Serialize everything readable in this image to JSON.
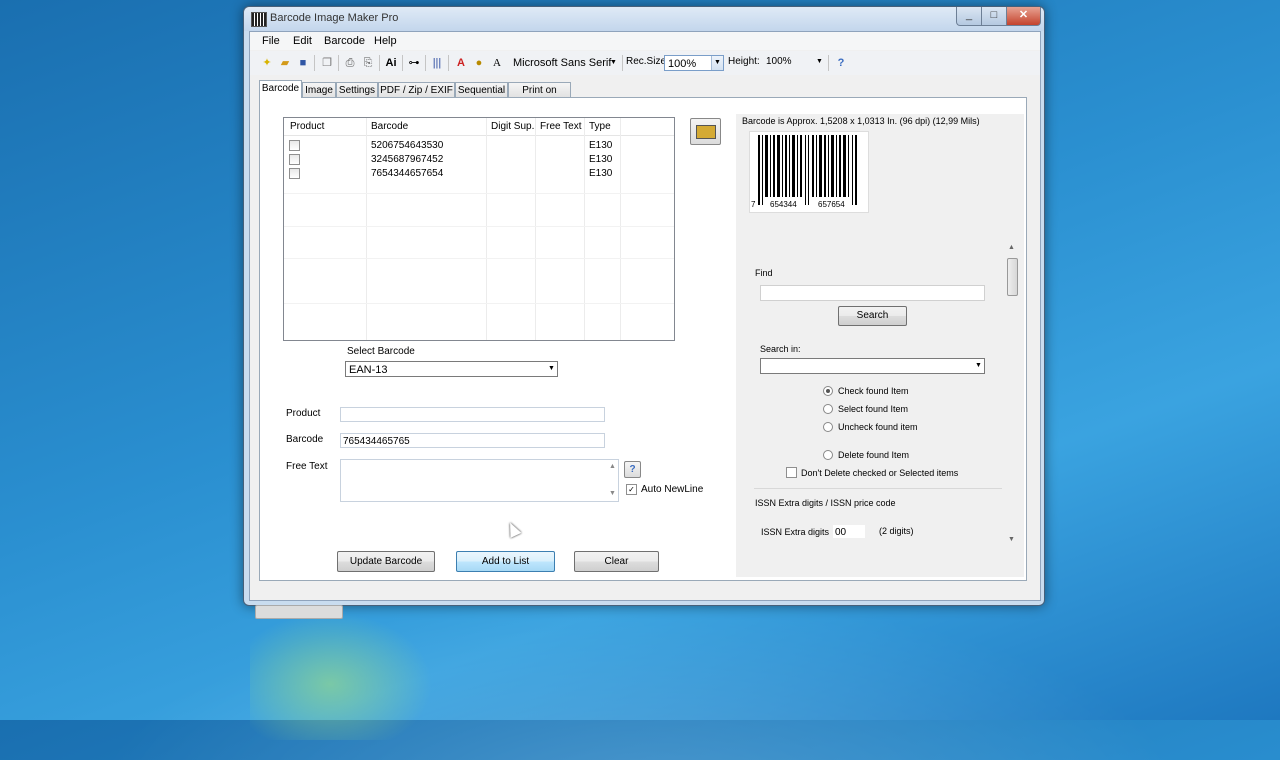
{
  "window": {
    "title": "Barcode Image Maker Pro",
    "min": "_",
    "max": "□",
    "close": "✕"
  },
  "menu": [
    "File",
    "Edit",
    "Barcode",
    "Help"
  ],
  "toolbar": {
    "font_name": "Microsoft Sans Serif",
    "rec_size_label": "Rec.Size",
    "rec_size_value": "100%",
    "height_label": "Height:",
    "height_value": "100%"
  },
  "tabs": [
    "Barcode",
    "Image",
    "Settings",
    "PDF / Zip / EXIF",
    "Sequential",
    "Print on Label"
  ],
  "list": {
    "columns": [
      "Product",
      "Barcode",
      "Digit Sup.",
      "Free Text",
      "Type"
    ],
    "rows": [
      {
        "product": "",
        "barcode": "5206754643530",
        "digit_sup": "",
        "free_text": "",
        "type": "E130"
      },
      {
        "product": "",
        "barcode": "3245687967452",
        "digit_sup": "",
        "free_text": "",
        "type": "E130"
      },
      {
        "product": "",
        "barcode": "7654344657654",
        "digit_sup": "",
        "free_text": "",
        "type": "E130"
      }
    ]
  },
  "select_barcode": {
    "label": "Select Barcode",
    "value": "EAN-13"
  },
  "form": {
    "product_label": "Product",
    "product_value": "",
    "barcode_label": "Barcode",
    "barcode_value": "765434465765",
    "free_text_label": "Free Text",
    "free_text_value": "",
    "auto_newline_label": "Auto NewLine",
    "help_glyph": "?"
  },
  "buttons": {
    "update": "Update Barcode",
    "add": "Add to List",
    "clear": "Clear"
  },
  "right": {
    "info": "Barcode is Approx. 1,5208 x 1,0313 In.  (96 dpi) (12,99 Mils)",
    "digits": [
      "7",
      "654344",
      "657654"
    ],
    "find_label": "Find",
    "find_value": "",
    "search_button": "Search",
    "search_in_label": "Search in:",
    "search_in_value": "",
    "radio_check": "Check found Item",
    "radio_select": "Select found Item",
    "radio_uncheck": "Uncheck found item",
    "radio_delete": "Delete found Item",
    "dont_delete": "Don't Delete checked or Selected items",
    "issn_group": "ISSN Extra digits / ISSN price code",
    "issn_label": "ISSN Extra digits",
    "issn_value": "00",
    "issn_hint": "(2 digits)"
  }
}
